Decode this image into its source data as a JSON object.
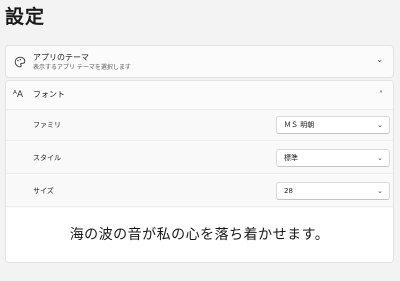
{
  "page": {
    "title": "設定"
  },
  "theme_card": {
    "icon": "palette-icon",
    "title": "アプリのテーマ",
    "subtitle": "表示するアプリ テーマを選択します",
    "chevron": "⌄"
  },
  "font_card": {
    "icon": "font-size-icon",
    "icon_glyph": "ᴬA",
    "title": "フォント",
    "chevron": "˄",
    "rows": [
      {
        "label": "ファミリ",
        "value": "ＭＳ 明朝",
        "chevron": "⌄"
      },
      {
        "label": "スタイル",
        "value": "標準",
        "chevron": "⌄"
      },
      {
        "label": "サイズ",
        "value": "28",
        "chevron": "⌄"
      }
    ],
    "preview_text": "海の波の音が私の心を落ち着かせます。"
  },
  "colors": {
    "background": "#f3f3f3",
    "card": "#fbfbfb",
    "preview": "#ffffff"
  }
}
